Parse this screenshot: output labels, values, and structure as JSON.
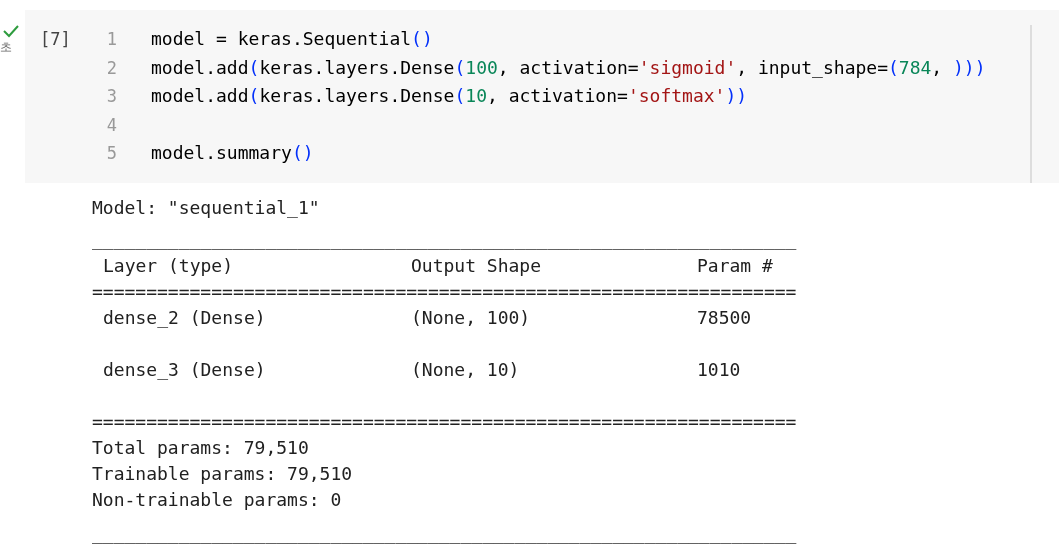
{
  "cell": {
    "status": "초",
    "succeeded": true,
    "execution_count": "[7]",
    "code": [
      {
        "number": "1",
        "tokens": [
          {
            "kind": "plain",
            "text": "model = keras.Sequential"
          },
          {
            "kind": "paren",
            "text": "()"
          }
        ]
      },
      {
        "number": "2",
        "tokens": [
          {
            "kind": "plain",
            "text": "model.add"
          },
          {
            "kind": "paren",
            "text": "("
          },
          {
            "kind": "plain",
            "text": "keras.layers.Dense"
          },
          {
            "kind": "paren",
            "text": "("
          },
          {
            "kind": "number",
            "text": "100"
          },
          {
            "kind": "plain",
            "text": ", activation="
          },
          {
            "kind": "string",
            "text": "'sigmoid'"
          },
          {
            "kind": "plain",
            "text": ", input_shape="
          },
          {
            "kind": "paren",
            "text": "("
          },
          {
            "kind": "number",
            "text": "784"
          },
          {
            "kind": "plain",
            "text": ", "
          },
          {
            "kind": "paren",
            "text": ")))"
          }
        ]
      },
      {
        "number": "3",
        "tokens": [
          {
            "kind": "plain",
            "text": "model.add"
          },
          {
            "kind": "paren",
            "text": "("
          },
          {
            "kind": "plain",
            "text": "keras.layers.Dense"
          },
          {
            "kind": "paren",
            "text": "("
          },
          {
            "kind": "number",
            "text": "10"
          },
          {
            "kind": "plain",
            "text": ", activation="
          },
          {
            "kind": "string",
            "text": "'softmax'"
          },
          {
            "kind": "paren",
            "text": "))"
          }
        ]
      },
      {
        "number": "4"
      },
      {
        "number": "5",
        "tokens": [
          {
            "kind": "plain",
            "text": "model.summary"
          },
          {
            "kind": "paren",
            "text": "()"
          }
        ]
      }
    ]
  },
  "output": {
    "title": "Model: \"sequential_1\"",
    "rule_top": "_________________________________________________________________",
    "columns": [
      "Layer (type)",
      "Output Shape",
      "Param #"
    ],
    "rule_header": "=================================================================",
    "rows": [
      [
        "dense_2 (Dense)",
        "(None, 100)",
        "78500"
      ],
      [
        "dense_3 (Dense)",
        "(None, 10)",
        "1010"
      ]
    ],
    "rule_bottom": "=================================================================",
    "totals": [
      "Total params: 79,510",
      "Trainable params: 79,510",
      "Non-trainable params: 0"
    ],
    "rule_end": "_________________________________________________________________"
  }
}
